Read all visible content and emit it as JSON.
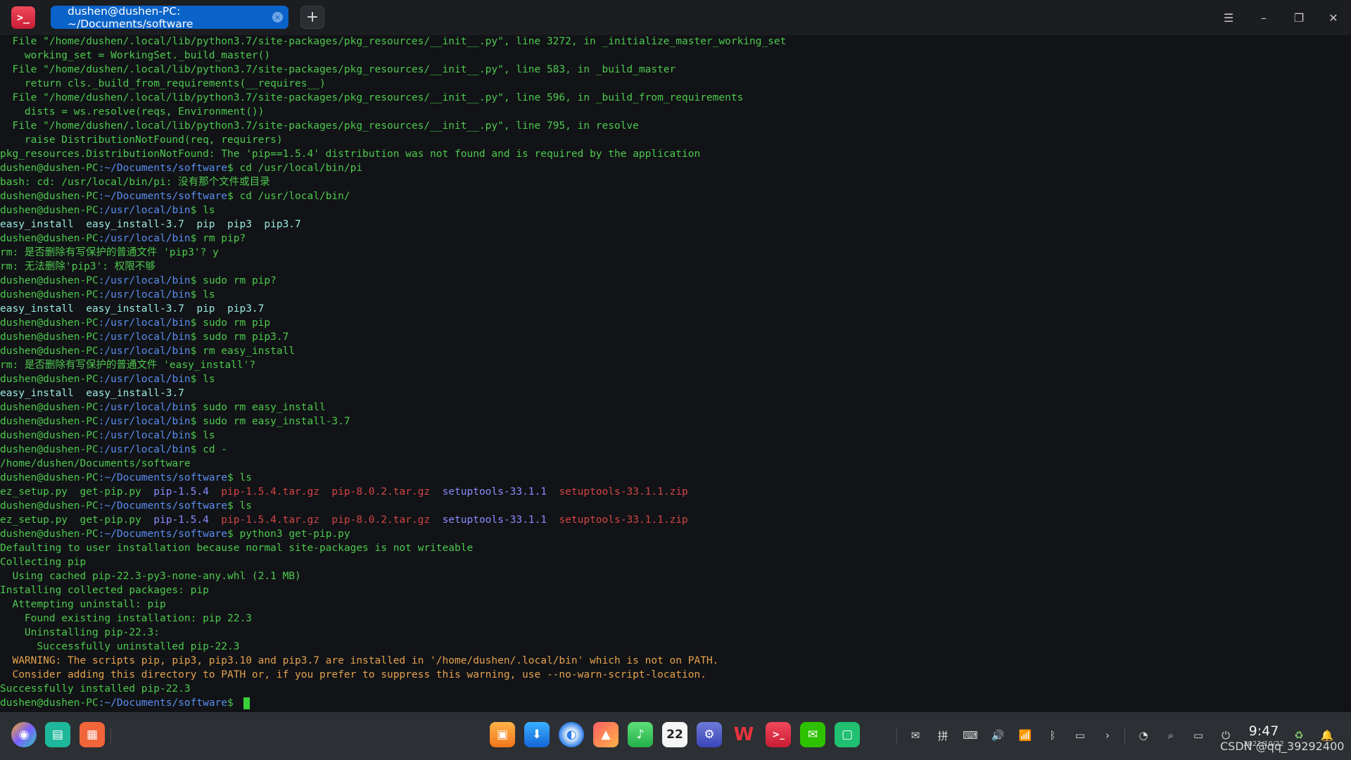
{
  "window": {
    "tab_title": "dushen@dushen-PC: ~/Documents/software",
    "tab_close": "×",
    "new_tab": "+",
    "logo_glyph": ">_",
    "menu_glyph": "☰",
    "min_glyph": "–",
    "max_glyph": "❐",
    "close_glyph": "✕"
  },
  "colors": {
    "output_green": "#4ec94e",
    "path_blue": "#5a8ef0",
    "tab_blue": "#0a63c9",
    "warning_orange": "#e5a24f",
    "archive_red": "#d24545"
  },
  "terminal": {
    "lines": [
      [
        [
          "  File \"/home/dushen/.local/lib/python3.7/site-packages/pkg_resources/__init__.py\", line 3272, in _initialize_master_working_set",
          "t-green"
        ]
      ],
      [
        [
          "    working_set = WorkingSet._build_master()",
          "t-green"
        ]
      ],
      [
        [
          "  File \"/home/dushen/.local/lib/python3.7/site-packages/pkg_resources/__init__.py\", line 583, in _build_master",
          "t-green"
        ]
      ],
      [
        [
          "    return cls._build_from_requirements(__requires__)",
          "t-green"
        ]
      ],
      [
        [
          "  File \"/home/dushen/.local/lib/python3.7/site-packages/pkg_resources/__init__.py\", line 596, in _build_from_requirements",
          "t-green"
        ]
      ],
      [
        [
          "    dists = ws.resolve(reqs, Environment())",
          "t-green"
        ]
      ],
      [
        [
          "  File \"/home/dushen/.local/lib/python3.7/site-packages/pkg_resources/__init__.py\", line 795, in resolve",
          "t-green"
        ]
      ],
      [
        [
          "    raise DistributionNotFound(req, requirers)",
          "t-green"
        ]
      ],
      [
        [
          "pkg_resources.DistributionNotFound: The 'pip==1.5.4' distribution was not found and is required by the application",
          "t-green"
        ]
      ],
      [
        [
          "dushen@dushen-PC",
          "t-green"
        ],
        [
          ":~/Documents/software",
          "t-path"
        ],
        [
          "$ cd /usr/local/bin/pi",
          "t-green"
        ]
      ],
      [
        [
          "bash: cd: /usr/local/bin/pi: 没有那个文件或目录",
          "t-green"
        ]
      ],
      [
        [
          "dushen@dushen-PC",
          "t-green"
        ],
        [
          ":~/Documents/software",
          "t-path"
        ],
        [
          "$ cd /usr/local/bin/",
          "t-green"
        ]
      ],
      [
        [
          "dushen@dushen-PC",
          "t-green"
        ],
        [
          ":/usr/local/bin",
          "t-path"
        ],
        [
          "$ ls",
          "t-green"
        ]
      ],
      [
        [
          "easy_install  easy_install-3.7  pip  pip3  pip3.7",
          "t-cyan"
        ]
      ],
      [
        [
          "dushen@dushen-PC",
          "t-green"
        ],
        [
          ":/usr/local/bin",
          "t-path"
        ],
        [
          "$ rm pip?",
          "t-green"
        ]
      ],
      [
        [
          "rm: 是否删除有写保护的普通文件 'pip3'? y",
          "t-green"
        ]
      ],
      [
        [
          "rm: 无法删除'pip3': 权限不够",
          "t-green"
        ]
      ],
      [
        [
          "dushen@dushen-PC",
          "t-green"
        ],
        [
          ":/usr/local/bin",
          "t-path"
        ],
        [
          "$ sudo rm pip?",
          "t-green"
        ]
      ],
      [
        [
          "dushen@dushen-PC",
          "t-green"
        ],
        [
          ":/usr/local/bin",
          "t-path"
        ],
        [
          "$ ls",
          "t-green"
        ]
      ],
      [
        [
          "easy_install  easy_install-3.7  pip  pip3.7",
          "t-cyan"
        ]
      ],
      [
        [
          "dushen@dushen-PC",
          "t-green"
        ],
        [
          ":/usr/local/bin",
          "t-path"
        ],
        [
          "$ sudo rm pip",
          "t-green"
        ]
      ],
      [
        [
          "dushen@dushen-PC",
          "t-green"
        ],
        [
          ":/usr/local/bin",
          "t-path"
        ],
        [
          "$ sudo rm pip3.7",
          "t-green"
        ]
      ],
      [
        [
          "dushen@dushen-PC",
          "t-green"
        ],
        [
          ":/usr/local/bin",
          "t-path"
        ],
        [
          "$ rm easy_install",
          "t-green"
        ]
      ],
      [
        [
          "rm: 是否删除有写保护的普通文件 'easy_install'?",
          "t-green"
        ]
      ],
      [
        [
          "dushen@dushen-PC",
          "t-green"
        ],
        [
          ":/usr/local/bin",
          "t-path"
        ],
        [
          "$ ls",
          "t-green"
        ]
      ],
      [
        [
          "easy_install  easy_install-3.7",
          "t-cyan"
        ]
      ],
      [
        [
          "dushen@dushen-PC",
          "t-green"
        ],
        [
          ":/usr/local/bin",
          "t-path"
        ],
        [
          "$ sudo rm easy_install",
          "t-green"
        ]
      ],
      [
        [
          "dushen@dushen-PC",
          "t-green"
        ],
        [
          ":/usr/local/bin",
          "t-path"
        ],
        [
          "$ sudo rm easy_install-3.7",
          "t-green"
        ]
      ],
      [
        [
          "dushen@dushen-PC",
          "t-green"
        ],
        [
          ":/usr/local/bin",
          "t-path"
        ],
        [
          "$ ls",
          "t-green"
        ]
      ],
      [
        [
          "dushen@dushen-PC",
          "t-green"
        ],
        [
          ":/usr/local/bin",
          "t-path"
        ],
        [
          "$ cd -",
          "t-green"
        ]
      ],
      [
        [
          "/home/dushen/Documents/software",
          "t-green"
        ]
      ],
      [
        [
          "dushen@dushen-PC",
          "t-green"
        ],
        [
          ":~/Documents/software",
          "t-path"
        ],
        [
          "$ ls",
          "t-green"
        ]
      ],
      [
        [
          "ez_setup.py  get-pip.py  ",
          "t-green"
        ],
        [
          "pip-1.5.4",
          "t-blue"
        ],
        [
          "  ",
          "t-green"
        ],
        [
          "pip-1.5.4.tar.gz  pip-8.0.2.tar.gz",
          "t-red"
        ],
        [
          "  ",
          "t-green"
        ],
        [
          "setuptools-33.1.1",
          "t-blue"
        ],
        [
          "  ",
          "t-green"
        ],
        [
          "setuptools-33.1.1.zip",
          "t-red"
        ]
      ],
      [
        [
          "dushen@dushen-PC",
          "t-green"
        ],
        [
          ":~/Documents/software",
          "t-path"
        ],
        [
          "$ ls",
          "t-green"
        ]
      ],
      [
        [
          "ez_setup.py  get-pip.py  ",
          "t-green"
        ],
        [
          "pip-1.5.4",
          "t-blue"
        ],
        [
          "  ",
          "t-green"
        ],
        [
          "pip-1.5.4.tar.gz  pip-8.0.2.tar.gz",
          "t-red"
        ],
        [
          "  ",
          "t-green"
        ],
        [
          "setuptools-33.1.1",
          "t-blue"
        ],
        [
          "  ",
          "t-green"
        ],
        [
          "setuptools-33.1.1.zip",
          "t-red"
        ]
      ],
      [
        [
          "dushen@dushen-PC",
          "t-green"
        ],
        [
          ":~/Documents/software",
          "t-path"
        ],
        [
          "$ python3 get-pip.py",
          "t-green"
        ]
      ],
      [
        [
          "Defaulting to user installation because normal site-packages is not writeable",
          "t-green"
        ]
      ],
      [
        [
          "Collecting pip",
          "t-green"
        ]
      ],
      [
        [
          "  Using cached pip-22.3-py3-none-any.whl (2.1 MB)",
          "t-green"
        ]
      ],
      [
        [
          "Installing collected packages: pip",
          "t-green"
        ]
      ],
      [
        [
          "  Attempting uninstall: pip",
          "t-green"
        ]
      ],
      [
        [
          "    Found existing installation: pip 22.3",
          "t-green"
        ]
      ],
      [
        [
          "    Uninstalling pip-22.3:",
          "t-green"
        ]
      ],
      [
        [
          "      Successfully uninstalled pip-22.3",
          "t-green"
        ]
      ],
      [
        [
          "  WARNING: The scripts pip, pip3, pip3.10 and pip3.7 are installed in '/home/dushen/.local/bin' which is not on PATH.",
          "t-orange"
        ]
      ],
      [
        [
          "  Consider adding this directory to PATH or, if you prefer to suppress this warning, use --no-warn-script-location.",
          "t-orange"
        ]
      ],
      [
        [
          "Successfully installed pip-22.3",
          "t-green"
        ]
      ],
      [
        [
          "dushen@dushen-PC",
          "t-green"
        ],
        [
          ":~/Documents/software",
          "t-path"
        ],
        [
          "$ ",
          "t-green"
        ]
      ]
    ]
  },
  "taskbar": {
    "left_icons": [
      {
        "name": "launcher-icon",
        "glyph": "◉"
      },
      {
        "name": "multitask-view-icon",
        "glyph": "▤"
      },
      {
        "name": "workspace-icon",
        "glyph": "▦"
      }
    ],
    "dock_icons": [
      {
        "name": "file-manager-icon",
        "glyph": "▣"
      },
      {
        "name": "app-store-icon",
        "glyph": "⬇"
      },
      {
        "name": "browser-icon",
        "glyph": "◐"
      },
      {
        "name": "image-viewer-icon",
        "glyph": "▲"
      },
      {
        "name": "music-icon",
        "glyph": "♪"
      },
      {
        "name": "calendar-icon",
        "glyph": "22"
      },
      {
        "name": "settings-icon",
        "glyph": "⚙"
      },
      {
        "name": "wps-icon",
        "glyph": "W"
      },
      {
        "name": "terminal-icon",
        "glyph": ">_"
      },
      {
        "name": "wechat-icon",
        "glyph": "✉"
      },
      {
        "name": "notes-icon",
        "glyph": "▢"
      }
    ],
    "tray_icons": [
      {
        "name": "wechat-tray-icon",
        "glyph": "✉"
      },
      {
        "name": "input-method-icon",
        "glyph": "拼"
      },
      {
        "name": "keyboard-icon",
        "glyph": "⌨"
      },
      {
        "name": "volume-icon",
        "glyph": "🔊"
      },
      {
        "name": "wifi-icon",
        "glyph": "📶"
      },
      {
        "name": "bluetooth-icon",
        "glyph": "ᛒ"
      },
      {
        "name": "battery-icon",
        "glyph": "▭"
      },
      {
        "name": "expand-tray-icon",
        "glyph": "›"
      },
      {
        "name": "performance-icon",
        "glyph": "◔"
      },
      {
        "name": "search-icon",
        "glyph": "⌕"
      },
      {
        "name": "screen-icon",
        "glyph": "▭"
      },
      {
        "name": "power-icon",
        "glyph": "⏻"
      }
    ],
    "time": "9:47",
    "date": "2022/10/22",
    "notification_glyph": "🔔",
    "trash_glyph": "♻"
  },
  "watermark": "CSDN @qq_39292400"
}
